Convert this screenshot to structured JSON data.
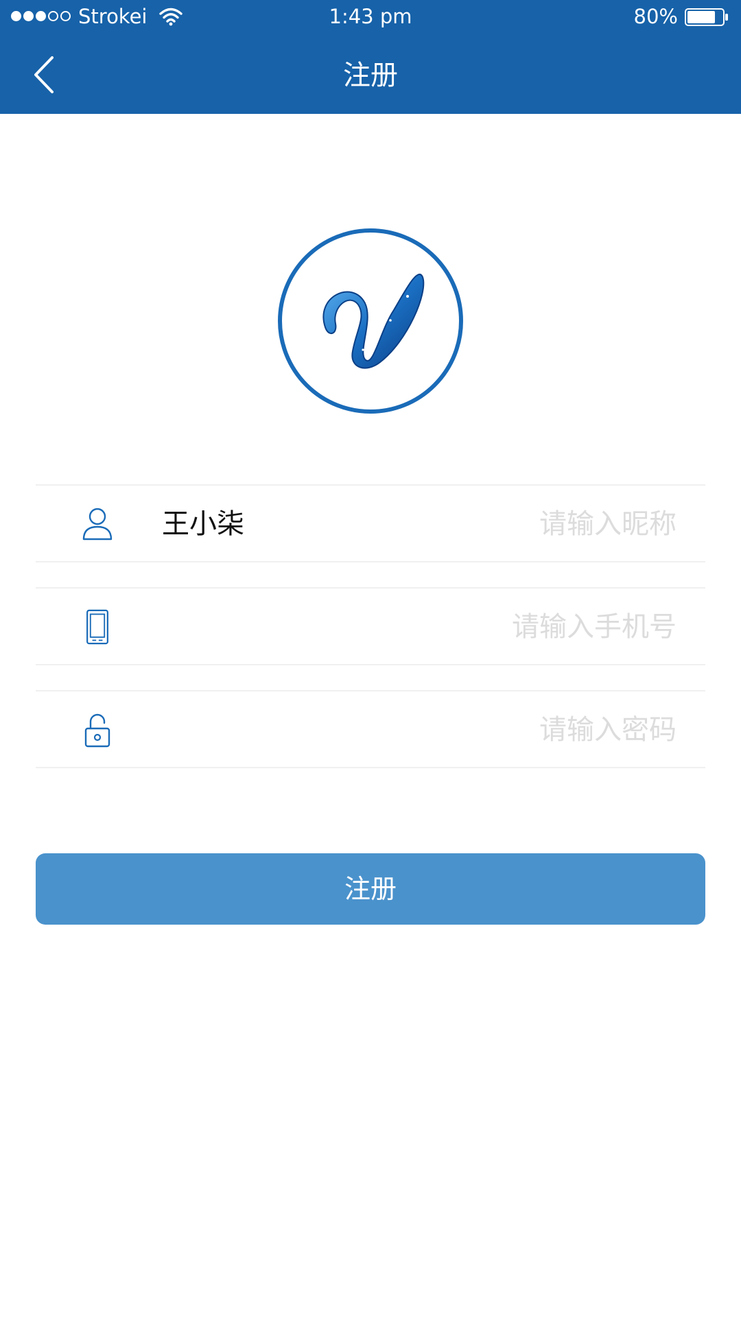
{
  "status_bar": {
    "carrier": "Strokei",
    "time": "1:43 pm",
    "battery_percent": "80%",
    "battery_level": 0.8,
    "signal_bars_filled": 3,
    "signal_bars_total": 5
  },
  "nav": {
    "title": "注册",
    "back_icon": "chevron-left-icon"
  },
  "logo": {
    "icon": "brand-logo-icon",
    "ring_color": "#1a6bb8"
  },
  "form": {
    "nickname": {
      "icon": "user-icon",
      "value": "王小柒",
      "placeholder": "请输入昵称"
    },
    "phone": {
      "icon": "phone-icon",
      "value": "",
      "placeholder": "请输入手机号"
    },
    "password": {
      "icon": "unlock-icon",
      "value": "",
      "placeholder": "请输入密码"
    }
  },
  "submit": {
    "label": "注册",
    "color": "#4a92cc"
  },
  "colors": {
    "header": "#1762a9",
    "icon": "#1a6bb8",
    "placeholder": "#dcdcdc",
    "divider": "#f0f0f0"
  }
}
